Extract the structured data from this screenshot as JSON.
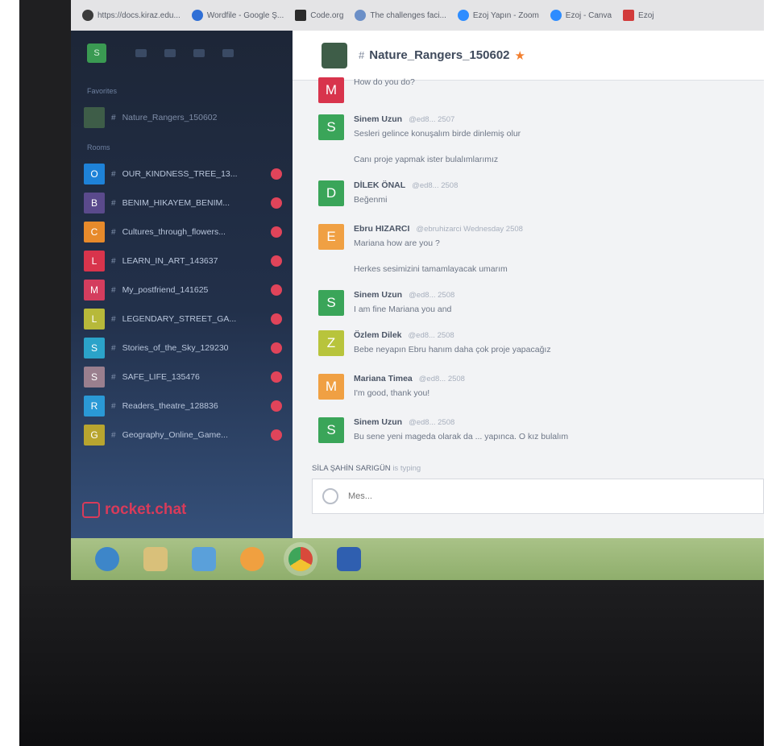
{
  "bookmarks": [
    {
      "label": "https://docs.kiraz.edu...",
      "color": "#3b3b3b"
    },
    {
      "label": "Wordfile - Google Ş...",
      "color": "#2f6fd6"
    },
    {
      "label": "Code.org",
      "color": "#2b2b2b"
    },
    {
      "label": "The challenges faci...",
      "color": "#6b8fc7"
    },
    {
      "label": "Ezoj Yapın - Zoom",
      "color": "#2d8cff"
    },
    {
      "label": "Ezoj - Canva",
      "color": "#2d8cff"
    },
    {
      "label": "Ezoj",
      "color": "#d23b3b"
    }
  ],
  "sidebar": {
    "me_initial": "S",
    "favorites_label": "Favorites",
    "favorite_room": "Nature_Rangers_150602",
    "rooms_label": "Rooms",
    "rooms": [
      {
        "initial": "O",
        "name": "OUR_KINDNESS_TREE_13...",
        "color": "#1e82d8"
      },
      {
        "initial": "B",
        "name": "BENIM_HIKAYEM_BENIM...",
        "color": "#5a4a8c"
      },
      {
        "initial": "C",
        "name": "Cultures_through_flowers...",
        "color": "#e78a2b"
      },
      {
        "initial": "L",
        "name": "LEARN_IN_ART_143637",
        "color": "#d8344c"
      },
      {
        "initial": "M",
        "name": "My_postfriend_141625",
        "color": "#d43d5e"
      },
      {
        "initial": "L",
        "name": "LEGENDARY_STREET_GA...",
        "color": "#b7b93a"
      },
      {
        "initial": "S",
        "name": "Stories_of_the_Sky_129230",
        "color": "#2ba3c9"
      },
      {
        "initial": "S",
        "name": "SAFE_LIFE_135476",
        "color": "#9a7f8e"
      },
      {
        "initial": "R",
        "name": "Readers_theatre_128836",
        "color": "#2a99d6"
      },
      {
        "initial": "G",
        "name": "Geography_Online_Game...",
        "color": "#b8a52f"
      }
    ],
    "brand": "rocket.chat"
  },
  "chat": {
    "room_title": "Nature_Rangers_150602",
    "messages": [
      {
        "initial": "M",
        "color": "#d8344c",
        "name": "",
        "handle": "",
        "lines": [
          "How do you do?"
        ]
      },
      {
        "initial": "S",
        "color": "#3aa559",
        "name": "Sinem Uzun",
        "handle": "@ed8... 2507",
        "lines": [
          "Sesleri gelince konuşalım birde dinlemiş olur",
          "Canı proje yapmak ister bulalımlarımız"
        ]
      },
      {
        "initial": "D",
        "color": "#3aa559",
        "name": "DİLEK ÖNAL",
        "handle": "@ed8... 2508",
        "lines": [
          "Beğenmi"
        ]
      },
      {
        "initial": "E",
        "color": "#f0a043",
        "name": "Ebru HIZARCI",
        "handle": "@ebruhizarci Wednesday 2508",
        "lines": [
          "Mariana how are you ?",
          "Herkes sesimizini tamamlayacak umarım"
        ]
      },
      {
        "initial": "S",
        "color": "#3aa559",
        "name": "Sinem Uzun",
        "handle": "@ed8... 2508",
        "lines": [
          "I am fine Mariana you and"
        ]
      },
      {
        "initial": "Z",
        "color": "#b8c43c",
        "name": "Özlem Dilek",
        "handle": "@ed8... 2508",
        "lines": [
          "Bebe neyapın Ebru hanım daha çok proje yapacağız"
        ]
      },
      {
        "initial": "M",
        "color": "#f0a043",
        "name": "Mariana Timea",
        "handle": "@ed8... 2508",
        "lines": [
          "I'm good, thank you!"
        ]
      },
      {
        "initial": "S",
        "color": "#3aa559",
        "name": "Sinem Uzun",
        "handle": "@ed8... 2508",
        "lines": [
          "Bu sene yeni mageda olarak da ... yapınca. O kız bulalım"
        ]
      }
    ],
    "typing_user": "SİLA ŞAHİN SARIGÜN",
    "typing_word": "is typing",
    "composer_placeholder": "Mes..."
  }
}
